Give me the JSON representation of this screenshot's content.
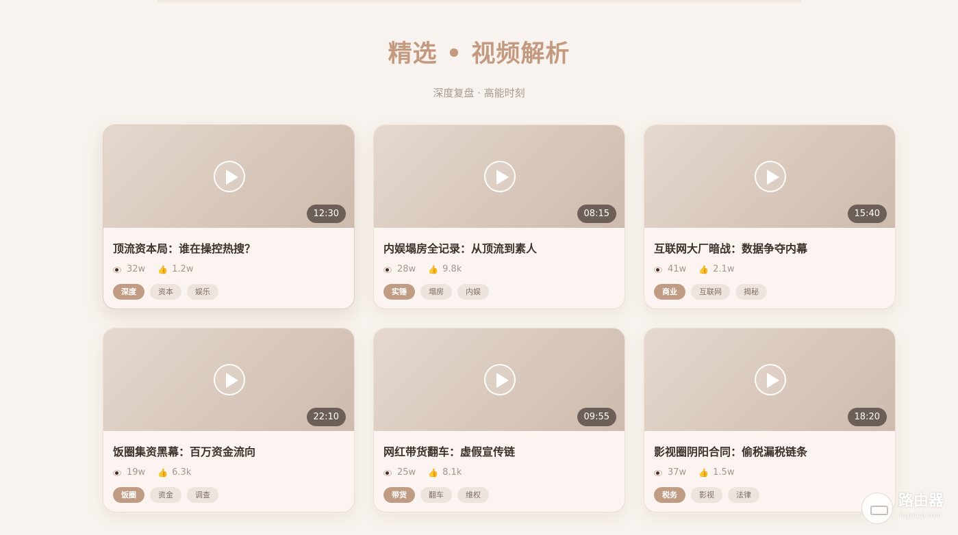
{
  "header": {
    "title": "精选 • 视频解析",
    "subtitle": "深度复盘 · 高能时刻"
  },
  "videos": [
    {
      "duration": "12:30",
      "title": "顶流资本局：谁在操控热搜？",
      "views": "32w",
      "likes": "1.2w",
      "tags": [
        "深度",
        "资本",
        "娱乐"
      ]
    },
    {
      "duration": "08:15",
      "title": "内娱塌房全记录：从顶流到素人",
      "views": "28w",
      "likes": "9.8k",
      "tags": [
        "实锤",
        "塌房",
        "内娱"
      ]
    },
    {
      "duration": "15:40",
      "title": "互联网大厂暗战：数据争夺内幕",
      "views": "41w",
      "likes": "2.1w",
      "tags": [
        "商业",
        "互联网",
        "揭秘"
      ]
    },
    {
      "duration": "22:10",
      "title": "饭圈集资黑幕：百万资金流向",
      "views": "19w",
      "likes": "6.3k",
      "tags": [
        "饭圈",
        "资金",
        "调查"
      ]
    },
    {
      "duration": "09:55",
      "title": "网红带货翻车：虚假宣传链",
      "views": "25w",
      "likes": "8.1k",
      "tags": [
        "带货",
        "翻车",
        "维权"
      ]
    },
    {
      "duration": "18:20",
      "title": "影视圈阴阳合同：偷税漏税链条",
      "views": "37w",
      "likes": "1.5w",
      "tags": [
        "税务",
        "影视",
        "法律"
      ]
    }
  ],
  "icons": {
    "views": "eye-icon",
    "likes": "thumbs-up-icon",
    "play": "play-icon"
  },
  "colors": {
    "accent": "#c39a7f",
    "primary_tag": "#c19c84",
    "duration_badge": "#6b5f58",
    "background": "#f8f3ee"
  },
  "watermark": {
    "text": "路由器",
    "sub": "luyouqi.com"
  }
}
